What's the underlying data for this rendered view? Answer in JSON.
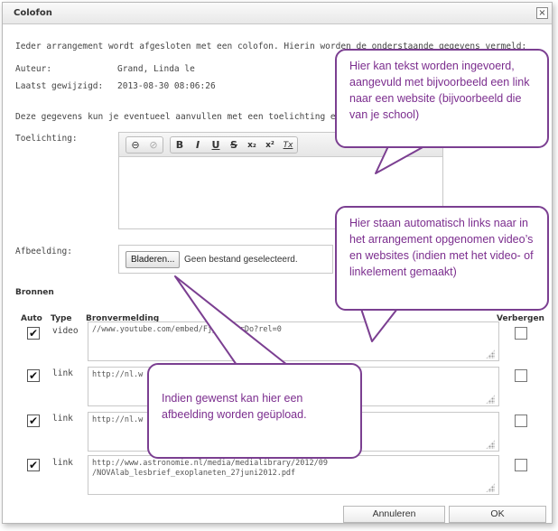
{
  "dialog": {
    "title": "Colofon",
    "close_label": "×"
  },
  "intro": "Ieder arrangement wordt afgesloten met een colofon. Hierin worden de onderstaande gegevens vermeld:",
  "meta": {
    "author_label": "Auteur:",
    "author_value": "Grand, Linda le",
    "modified_label": "Laatst gewijzigd:",
    "modified_value": "2013-08-30 08:06:26"
  },
  "supplement": "Deze gegevens kun je eventueel aanvullen met een toelichting en een a",
  "toelichting_label": "Toelichting:",
  "toolbar": {
    "link": "⊖",
    "unlink": "⊘",
    "bold": "B",
    "italic": "I",
    "underline": "U",
    "strike": "S",
    "subscript": "x₂",
    "superscript": "x²",
    "clear": "Tx"
  },
  "afbeelding": {
    "label": "Afbeelding:",
    "browse_label": "Bladeren...",
    "status": "Geen bestand geselecteerd."
  },
  "bronnen": {
    "heading": "Bronnen",
    "columns": {
      "auto": "Auto",
      "type": "Type",
      "source": "Bronvermelding",
      "hide": "Verbergen"
    },
    "rows": [
      {
        "auto": true,
        "type": "video",
        "source": "//www.youtube.com/embed/Fj_PjkQqrDo?rel=0",
        "hide": false
      },
      {
        "auto": true,
        "type": "link",
        "source": "http://nl.w",
        "hide": false
      },
      {
        "auto": true,
        "type": "link",
        "source": "http://nl.w",
        "hide": false
      },
      {
        "auto": true,
        "type": "link",
        "source": "http://www.astronomie.nl/media/medialibrary/2012/09\n/NOVAlab_lesbrief_exoplaneten_27juni2012.pdf",
        "hide": false
      }
    ]
  },
  "buttons": {
    "cancel": "Annuleren",
    "ok": "OK"
  },
  "callouts": {
    "text_info": "Hier kan tekst worden ingevoerd, aangevuld met bijvoorbeeld een link naar een website (bijvoorbeeld die van je school)",
    "links_info": "Hier staan automatisch links naar in het arrangement opgenomen video’s en websites (indien met het video- of linkelement gemaakt)",
    "image_info": "Indien gewenst kan hier een afbeelding worden geüpload."
  },
  "colors": {
    "callout": "#7b2d8e",
    "callout_border": "#7b3f91"
  }
}
